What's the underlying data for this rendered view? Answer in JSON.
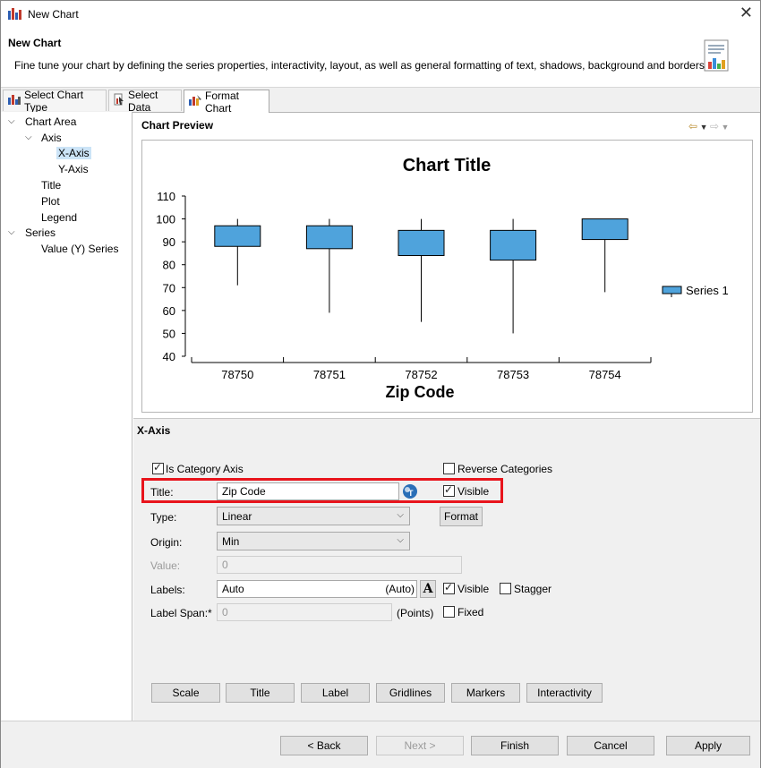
{
  "window": {
    "title": "New Chart"
  },
  "header": {
    "title": "New Chart",
    "description": "Fine tune your chart by defining the series properties, interactivity, layout, as well as general formatting of text, shadows, background and borders."
  },
  "tabs": [
    {
      "label": "Select Chart Type"
    },
    {
      "label": "Select Data"
    },
    {
      "label": "Format Chart"
    }
  ],
  "tree": {
    "chart_area": "Chart Area",
    "axis": "Axis",
    "x_axis": "X-Axis",
    "y_axis": "Y-Axis",
    "title": "Title",
    "plot": "Plot",
    "legend": "Legend",
    "series": "Series",
    "value_series": "Value (Y) Series"
  },
  "preview": {
    "header": "Chart Preview"
  },
  "chart_data": {
    "type": "box",
    "title": "Chart Title",
    "xlabel": "Zip Code",
    "ylabel": "",
    "ylim": [
      40,
      110
    ],
    "yticks": [
      40,
      50,
      60,
      70,
      80,
      90,
      100,
      110
    ],
    "categories": [
      "78750",
      "78751",
      "78752",
      "78753",
      "78754"
    ],
    "series": [
      {
        "name": "Series 1",
        "box_low": [
          88,
          87,
          84,
          82,
          91
        ],
        "box_high": [
          97,
          97,
          95,
          95,
          100
        ],
        "whisker_low": [
          71,
          59,
          55,
          50,
          68
        ],
        "whisker_high": [
          100,
          100,
          100,
          100,
          100
        ]
      }
    ],
    "legend": "right",
    "grid": false,
    "color": "#4fa3dc"
  },
  "section": {
    "title": "X-Axis"
  },
  "form": {
    "is_category_axis": "Is Category Axis",
    "reverse_categories": "Reverse Categories",
    "title_label": "Title:",
    "title_value": "Zip Code",
    "title_visible": "Visible",
    "type_label": "Type:",
    "type_value": "Linear",
    "format_button": "Format",
    "origin_label": "Origin:",
    "origin_value": "Min",
    "value_label": "Value:",
    "value_value": "0",
    "labels_label": "Labels:",
    "labels_value": "Auto",
    "labels_auto": "(Auto)",
    "labels_visible": "Visible",
    "stagger": "Stagger",
    "label_span_label": "Label Span:*",
    "label_span_value": "0",
    "points": "(Points)",
    "fixed": "Fixed",
    "bottom_buttons": [
      "Scale",
      "Title",
      "Label",
      "Gridlines",
      "Markers",
      "Interactivity"
    ]
  },
  "footer": {
    "back": "< Back",
    "next": "Next >",
    "finish": "Finish",
    "cancel": "Cancel",
    "apply": "Apply"
  }
}
